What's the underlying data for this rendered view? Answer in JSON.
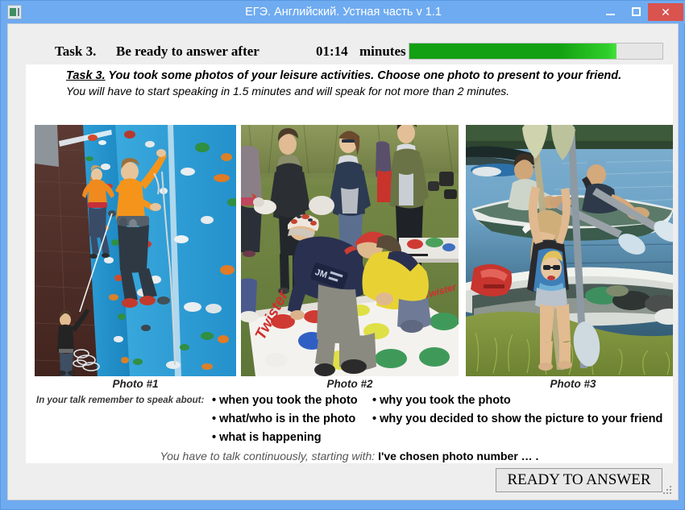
{
  "window": {
    "title": "ЕГЭ. Английский. Устная часть v 1.1",
    "app_icon": "app-window-icon",
    "minimize_label": "minimize-icon",
    "maximize_label": "maximize-icon",
    "close_label": "✕",
    "frame_color": "#6fabf0",
    "close_color": "#d9534f"
  },
  "status": {
    "task_label": "Task 3.",
    "ready_after_label": "Be ready to answer after",
    "timer": "01:14",
    "minutes_label": "minutes",
    "progress_percent": 82,
    "progress_color": "#13a012"
  },
  "task": {
    "heading_prefix": "Task 3.",
    "heading_text": " You took some photos of your leisure activities. Choose one photo to present to your friend.",
    "subheading": "You will have to start speaking in 1.5 minutes and will speak for not more than 2 minutes."
  },
  "photos": [
    {
      "caption": "Photo #1",
      "alt": "People climbing an indoor blue climbing wall with colorful holds; a belayer stands on the floor below"
    },
    {
      "caption": "Photo #2",
      "alt": "A group of young people playing Twister on a mat outdoors on grass in autumn"
    },
    {
      "caption": "Photo #3",
      "alt": "A girl holding paddles next to canoes on a riverbank, with people sitting in a kayak on the water"
    }
  ],
  "prompt": {
    "remember_label": "In your talk remember to speak about:",
    "bullets_left": [
      "when you took the photo",
      "what/who is in the photo",
      "what is happening"
    ],
    "bullets_right": [
      "why you took the photo",
      "why you decided to show the picture to your friend"
    ],
    "bullet_symbol": "•",
    "closing_prefix": "You have to talk continuously, starting with:",
    "closing_phrase": "I've chosen photo number … ."
  },
  "actions": {
    "ready_button": "READY TO ANSWER"
  }
}
